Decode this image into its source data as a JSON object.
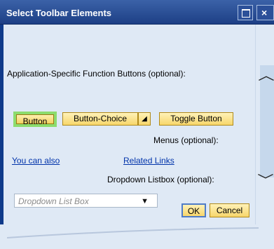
{
  "window": {
    "title": "Select Toolbar Elements",
    "controls": {
      "maximize_icon": "maximize-icon",
      "close_icon": "close-icon",
      "close_symbol": "×"
    }
  },
  "sections": {
    "function_buttons_label": "Application-Specific Function Buttons (optional):",
    "menus_label": "Menus (optional):",
    "dropdown_label": "Dropdown Listbox (optional):"
  },
  "buttons": {
    "button": "Button",
    "button_choice": "Button-Choice",
    "toggle_button": "Toggle Button"
  },
  "links": {
    "you_can_also": "You can also",
    "related_links": "Related Links"
  },
  "dropdown": {
    "placeholder": "Dropdown List Box"
  },
  "footer": {
    "ok": "OK",
    "cancel": "Cancel"
  },
  "colors": {
    "title_bar": "#1d3f86",
    "accent_green": "#8cdc6d",
    "button_yellow": "#f7d66b"
  }
}
